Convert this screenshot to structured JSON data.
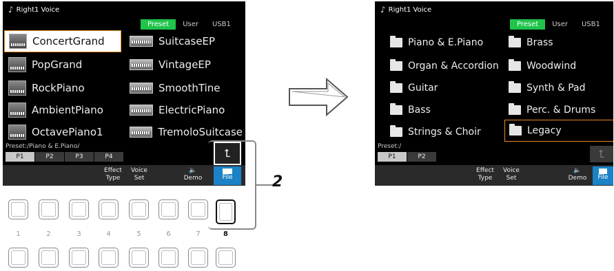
{
  "left_screen": {
    "title": "Right1 Voice",
    "tabs": [
      "Preset",
      "User",
      "USB1"
    ],
    "active_tab": "Preset",
    "voices_col1": [
      "ConcertGrand",
      "PopGrand",
      "RockPiano",
      "AmbientPiano",
      "OctavePiano1"
    ],
    "voices_col2": [
      "SuitcaseEP",
      "VintageEP",
      "SmoothTine",
      "ElectricPiano",
      "TremoloSuitcase"
    ],
    "selected_voice": "ConcertGrand",
    "path": "Preset:/Piano & E.Piano/",
    "pages": [
      "P1",
      "P2",
      "P3",
      "P4"
    ],
    "active_page": "P1",
    "effect_type": "Effect\nType",
    "effect_label_1": "Effect",
    "effect_label_2": "Type",
    "voice_set_1": "Voice",
    "voice_set_2": "Set",
    "demo": "Demo",
    "file": "File"
  },
  "right_screen": {
    "title": "Right1 Voice",
    "tabs": [
      "Preset",
      "User",
      "USB1"
    ],
    "active_tab": "Preset",
    "folders_col1": [
      "Piano & E.Piano",
      "Organ & Accordion",
      "Guitar",
      "Bass",
      "Strings & Choir"
    ],
    "folders_col2": [
      "Brass",
      "Woodwind",
      "Synth & Pad",
      "Perc. & Drums",
      "Legacy"
    ],
    "selected_folder": "Legacy",
    "path": "Preset:/",
    "pages": [
      "P1",
      "P2"
    ],
    "active_page": "P1",
    "effect_label_1": "Effect",
    "effect_label_2": "Type",
    "voice_set_1": "Voice",
    "voice_set_2": "Set",
    "demo": "Demo",
    "file": "File"
  },
  "panel": {
    "button_numbers": [
      "1",
      "2",
      "3",
      "4",
      "5",
      "6",
      "7",
      "8"
    ],
    "highlighted_button": "8",
    "callout": "2"
  },
  "icons": {
    "up": "up-arrow-icon",
    "arrow": "right-arrow-icon",
    "speaker": "speaker-icon",
    "folder": "folder-icon",
    "note": "music-note-icon"
  }
}
